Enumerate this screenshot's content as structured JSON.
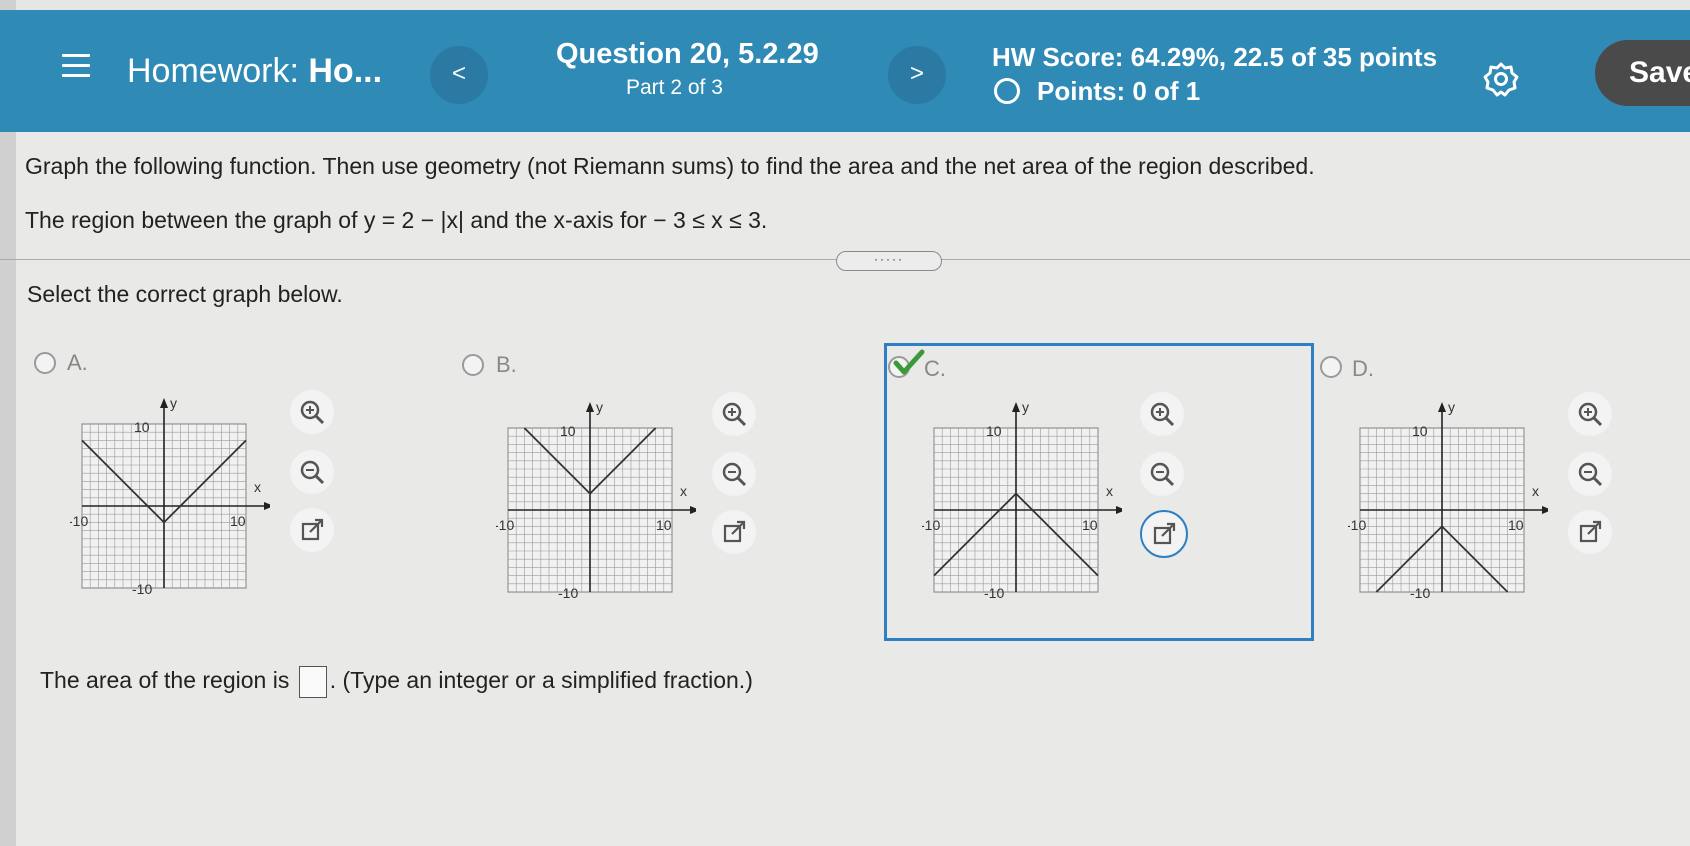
{
  "header": {
    "hw_title_prefix": "Homework: ",
    "hw_title_bold": "Ho...",
    "prev_label": "<",
    "next_label": ">",
    "question_title": "Question 20, 5.2.29",
    "question_part": "Part 2 of 3",
    "hw_score": "HW Score: 64.29%, 22.5 of 35 points",
    "points": "Points: 0 of 1",
    "save_label": "Save"
  },
  "problem": {
    "instructions": "Graph the following function. Then use geometry (not Riemann sums) to find the area and the net area of the region described.",
    "region_description": "The region between the graph of y = 2 − |x| and the x-axis for  − 3 ≤ x ≤ 3.",
    "expand_dots": "·····",
    "select_prompt": "Select the correct graph below."
  },
  "options": [
    {
      "letter": "A.",
      "selected": false,
      "shape": "V",
      "vertex": [
        0,
        -2
      ]
    },
    {
      "letter": "B.",
      "selected": false,
      "shape": "V",
      "vertex": [
        0,
        2
      ]
    },
    {
      "letter": "C.",
      "selected": true,
      "shape": "inverted-V",
      "vertex": [
        0,
        2
      ]
    },
    {
      "letter": "D.",
      "selected": false,
      "shape": "inverted-V",
      "vertex": [
        0,
        -2
      ]
    }
  ],
  "graph_labels": {
    "y": "y",
    "x": "x",
    "ymax": "10",
    "ymin": "-10",
    "xmin": "-10",
    "xmax": "10"
  },
  "answer": {
    "prefix": "The area of the region is",
    "suffix": ". (Type an integer or a simplified fraction.)",
    "value": ""
  },
  "colors": {
    "header": "#2f8ab5",
    "selected_border": "#2f7fc4",
    "check": "#3a9a3a"
  }
}
